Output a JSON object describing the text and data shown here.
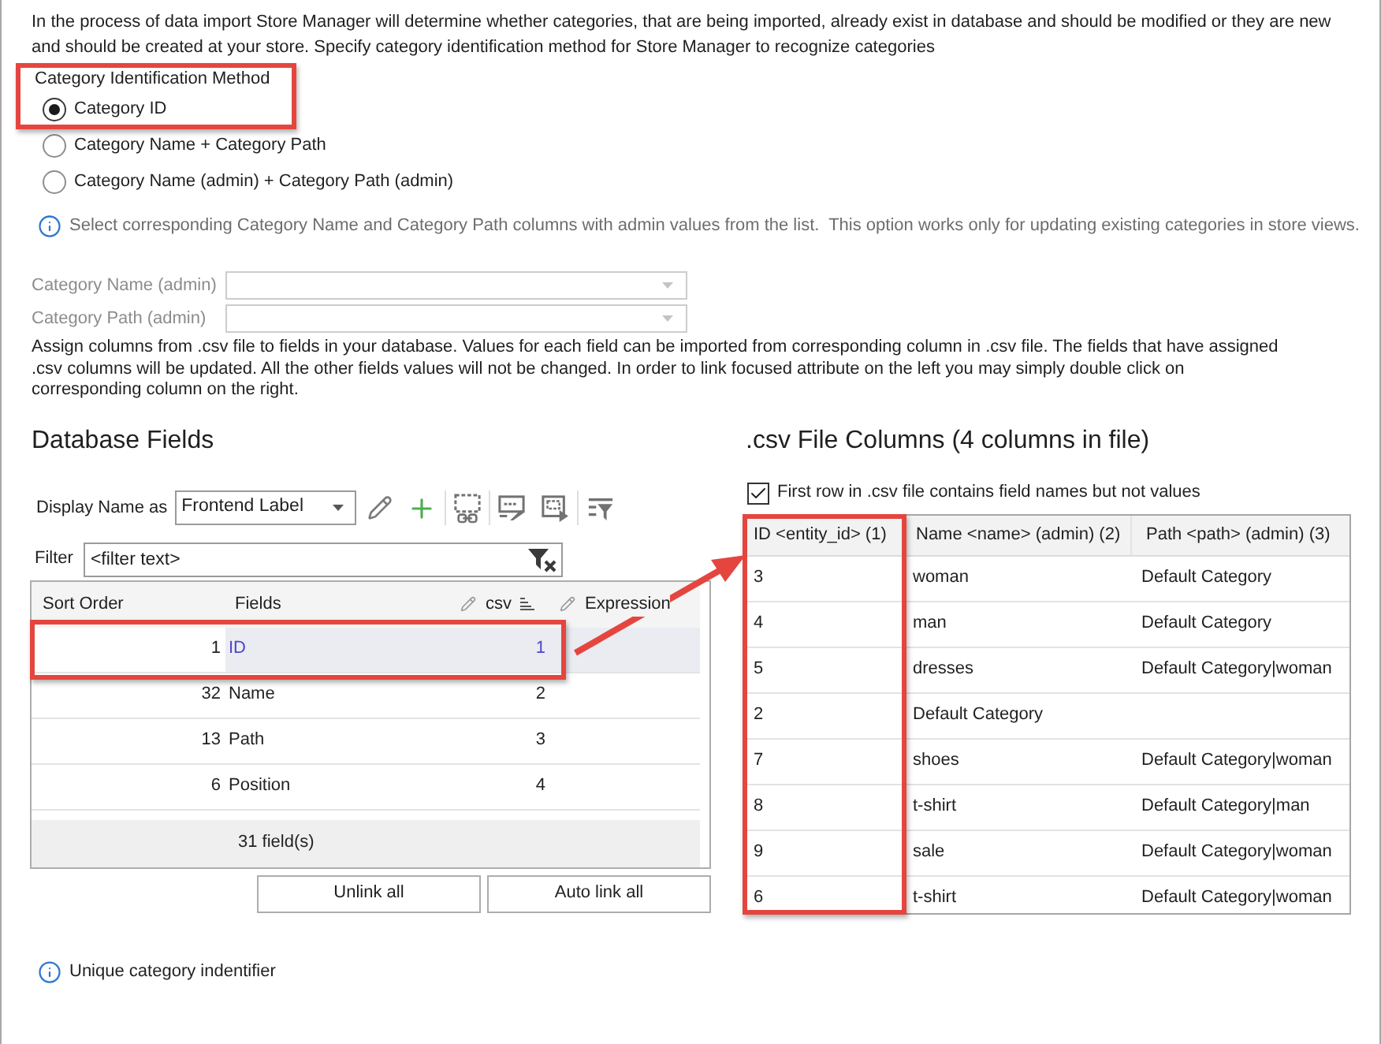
{
  "intro": "In the process of data import Store Manager will determine whether categories, that are being imported, already exist in database and should be modified or they are new and should be created at your store. Specify category identification method for Store Manager to recognize categories",
  "identification_method": {
    "label": "Category Identification Method",
    "options": [
      {
        "label": "Category ID",
        "selected": true
      },
      {
        "label": "Category Name + Category Path",
        "selected": false
      },
      {
        "label": "Category Name (admin) + Category Path (admin)",
        "selected": false
      }
    ]
  },
  "admin_note": "Select corresponding Category Name and Category Path columns with admin values from the list.  This option works only for updating existing categories in store views.",
  "admin_fields": [
    {
      "label": "Category Name (admin)",
      "disabled": true
    },
    {
      "label": "Category Path (admin)",
      "disabled": true
    }
  ],
  "assign_note": "Assign columns from .csv file to fields in your database. Values for each field can be imported from corresponding column in .csv file. The fields that have assigned .csv columns will be updated. All the other fields values will not be changed. In order to link focused attribute on the left you may simply double click on corresponding column on the right.",
  "database_fields": {
    "title": "Database Fields",
    "display_name": {
      "label": "Display Name as",
      "value": "Frontend Label"
    },
    "filter": {
      "label": "Filter",
      "placeholder": "<filter text>"
    },
    "columns": [
      "Sort Order",
      "Fields",
      "csv",
      "Expression"
    ],
    "rows": [
      {
        "sort_order": "1",
        "field": "ID",
        "csv": "1",
        "selected": true
      },
      {
        "sort_order": "32",
        "field": "Name",
        "csv": "2",
        "selected": false
      },
      {
        "sort_order": "13",
        "field": "Path",
        "csv": "3",
        "selected": false
      },
      {
        "sort_order": "6",
        "field": "Position",
        "csv": "4",
        "selected": false
      }
    ],
    "footer": "31 field(s)",
    "buttons": [
      "Unlink all",
      "Auto link all"
    ]
  },
  "csv_columns": {
    "title": ".csv File Columns (4 columns in file)",
    "first_row_names": {
      "label": "First row in .csv file contains field names but not values",
      "checked": true
    },
    "columns": [
      "ID <entity_id> (1)",
      "Name <name> (admin) (2)",
      "Path <path> (admin) (3)"
    ],
    "rows": [
      {
        "id": "3",
        "name": "woman",
        "path": "Default Category"
      },
      {
        "id": "4",
        "name": "man",
        "path": "Default Category"
      },
      {
        "id": "5",
        "name": "dresses",
        "path": "Default Category|woman"
      },
      {
        "id": "2",
        "name": "Default Category"
      },
      {
        "id": "7",
        "name": "shoes",
        "path": "Default Category|woman"
      },
      {
        "id": "8",
        "name": "t-shirt",
        "path": "Default Category|man"
      },
      {
        "id": "9",
        "name": "sale",
        "path": "Default Category|woman"
      },
      {
        "id": "6",
        "name": "t-shirt",
        "path": "Default Category|woman"
      }
    ]
  },
  "hint": "Unique category indentifier"
}
